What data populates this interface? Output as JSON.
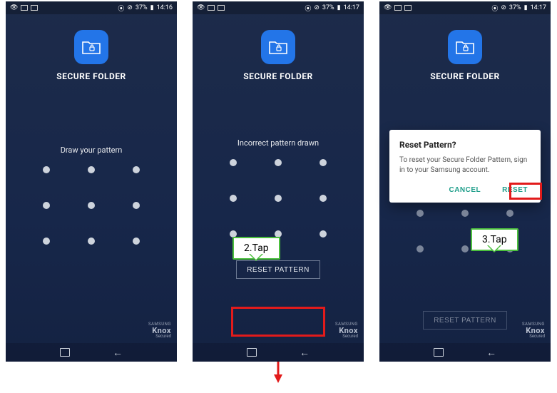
{
  "status": {
    "battery_text": "37%",
    "time1": "14:16",
    "time2": "14:17",
    "time3": "14:17"
  },
  "app": {
    "title": "SECURE FOLDER"
  },
  "screens": {
    "s1": {
      "prompt": "Draw your pattern"
    },
    "s2": {
      "prompt": "Incorrect pattern drawn",
      "reset_btn": "RESET PATTERN"
    },
    "s3": {
      "reset_btn": "RESET PATTERN"
    }
  },
  "dialog": {
    "title": "Reset Pattern?",
    "body": "To reset your Secure Folder Pattern, sign in to your Samsung account.",
    "cancel": "CANCEL",
    "reset": "RESET"
  },
  "knox": {
    "brand": "SAMSUNG",
    "name": "Knox",
    "sub": "Secured"
  },
  "annotations": {
    "tap2": "2.Tap",
    "tap3": "3.Tap"
  }
}
